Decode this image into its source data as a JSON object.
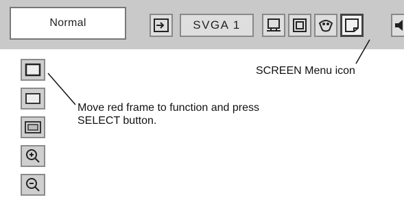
{
  "menu_bar": {
    "mode_label": "Normal",
    "source_label": "SVGA 1",
    "icons": [
      "input-icon",
      "system-icon",
      "image-select-icon",
      "image-adjust-icon",
      "screen-icon",
      "sound-icon"
    ]
  },
  "screen_menu": {
    "items": [
      "normal-icon",
      "true-icon",
      "wide-icon",
      "digital-zoom-plus-icon",
      "digital-zoom-minus-icon"
    ]
  },
  "annotations": {
    "screen_menu_icon": "SCREEN Menu icon",
    "instruction_line1": "Move red frame to function and press",
    "instruction_line2": "SELECT button."
  }
}
